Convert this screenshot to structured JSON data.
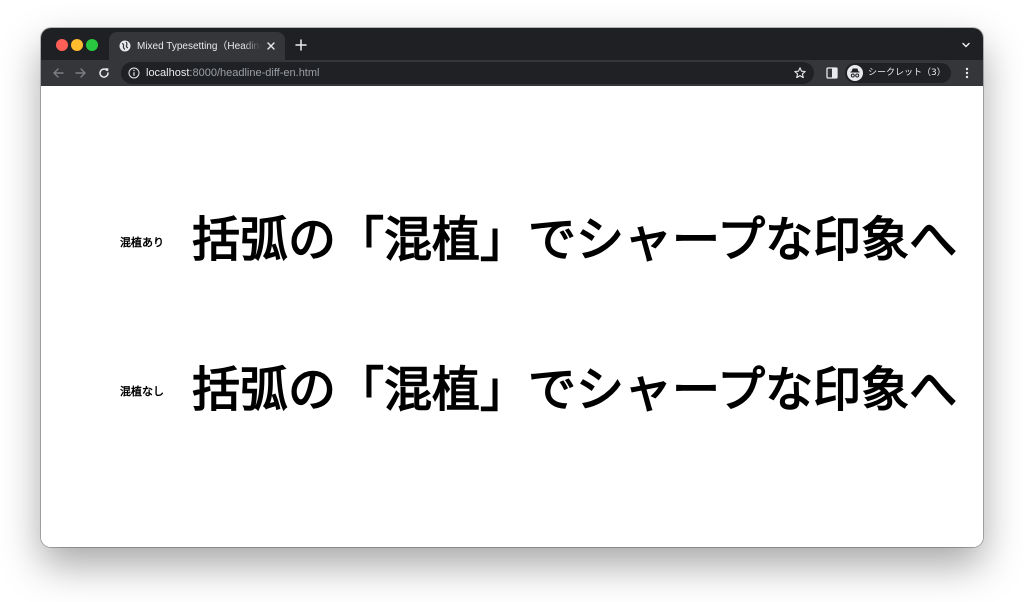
{
  "browser": {
    "tab_title": "Mixed Typesetting（Headings | ",
    "url_host": "localhost",
    "url_rest": ":8000/headline-diff-en.html",
    "profile_label": "シークレット（3）"
  },
  "page": {
    "rows": [
      {
        "label": "混植あり",
        "headline": "括弧の「混植」でシャープな印象へ"
      },
      {
        "label": "混植なし",
        "headline": "括弧の「混植」でシャープな印象へ"
      }
    ]
  },
  "colors": {
    "tabstrip": "#1f2023",
    "toolbar": "#35363a",
    "omnibox": "#202124",
    "traffic_close": "#ff5f57",
    "traffic_min": "#febc2e",
    "traffic_max": "#28c840"
  },
  "icons": [
    "globe-favicon-icon",
    "close-icon",
    "plus-icon",
    "chevron-down-icon",
    "back-arrow-icon",
    "forward-arrow-icon",
    "reload-icon",
    "info-icon",
    "star-icon",
    "side-panel-icon",
    "incognito-icon",
    "kebab-menu-icon"
  ]
}
